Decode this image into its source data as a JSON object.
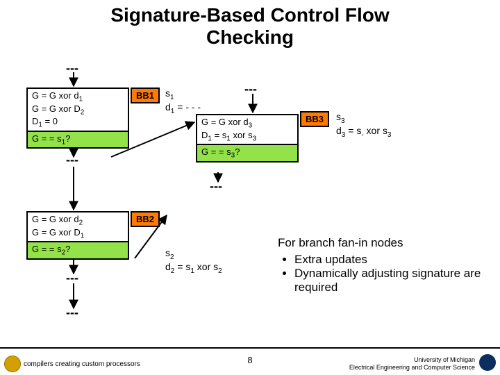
{
  "title_l1": "Signature-Based Control Flow",
  "title_l2": "Checking",
  "dashes": "---",
  "bb1": {
    "tag": "BB1",
    "body_l1": "G = G xor d",
    "body_l2": "G = G xor D",
    "body_l3": "D",
    "body_l3_tail": " = 0",
    "check": "G = = s",
    "check_tail": "?",
    "meta_l1": "s",
    "meta_l2": "d",
    "meta_l2_tail": " = - - -"
  },
  "bb2": {
    "tag": "BB2",
    "body_l1": "G = G xor d",
    "body_l2": "G = G xor D",
    "check": "G = = s",
    "check_tail": "?",
    "meta_l1": "s",
    "meta_l2": "d",
    "meta_l2_tail": " = s",
    "meta_l2_tail2": " xor s"
  },
  "bb3": {
    "tag": "BB3",
    "body_l1": "G = G xor d",
    "body_l2": "D",
    "body_l2_mid": " = s",
    "body_l2_tail": " xor s",
    "check": "G = = s",
    "check_tail": "?",
    "meta_l1": "s",
    "meta_l2": "d",
    "meta_l2_mid": " = s",
    "meta_l2_tail": " xor s"
  },
  "notes_hdr": "For branch fan-in nodes",
  "notes_b1": "Extra updates",
  "notes_b2": "Dynamically adjusting signature are required",
  "brand_site": "compilers creating custom processors",
  "page_num": "8",
  "uni_l1": "University of Michigan",
  "uni_l2": "Electrical Engineering and Computer Science"
}
